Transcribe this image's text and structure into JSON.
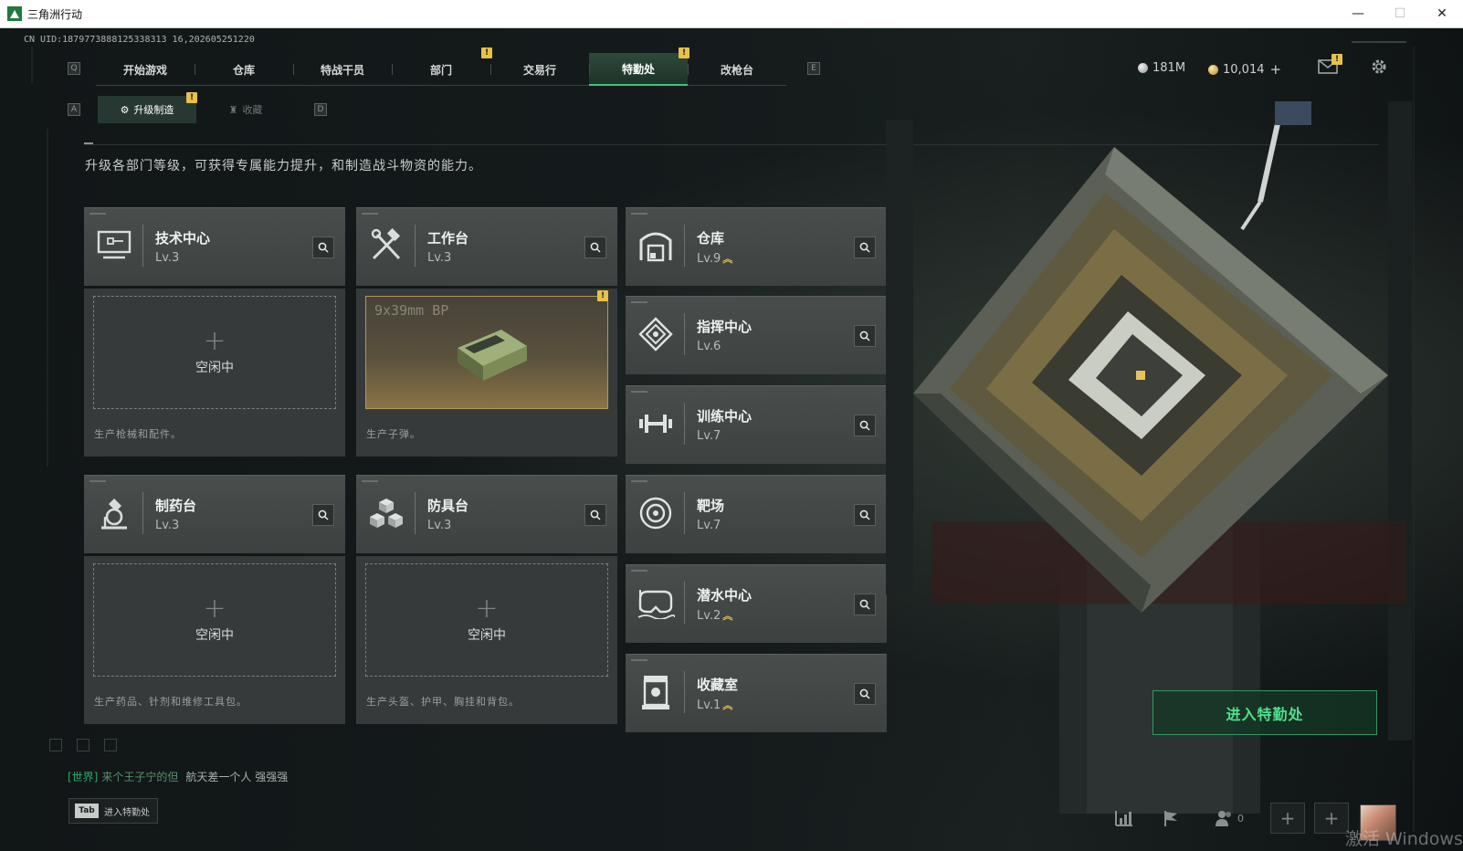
{
  "window": {
    "title": "三角洲行动",
    "minimize": "—",
    "maximize": "☐",
    "close": "✕"
  },
  "uid": "CN UID:1879773888125338313 16,202605251220",
  "nav": {
    "left_key": "Q",
    "right_key": "E",
    "tabs": [
      {
        "label": "开始游戏"
      },
      {
        "label": "仓库"
      },
      {
        "label": "特战干员"
      },
      {
        "label": "部门"
      },
      {
        "label": "交易行"
      },
      {
        "label": "特勤处"
      },
      {
        "label": "改枪台"
      }
    ],
    "active_tab": "特勤处",
    "badge": "!"
  },
  "currency": {
    "silver": "181M",
    "gold": "10,014",
    "gold_add": "+"
  },
  "subtabs": {
    "left_key": "A",
    "right_key": "D",
    "items": [
      {
        "label": "升级制造"
      },
      {
        "label": "收藏"
      }
    ]
  },
  "description": "升级各部门等级，可获得专属能力提升，和制造战斗物资的能力。",
  "cards": {
    "tech": {
      "name": "技术中心",
      "level": "Lv.3",
      "slot_idle": "空闲中",
      "slot_desc": "生产枪械和配件。",
      "plus": "+"
    },
    "workbench": {
      "name": "工作台",
      "level": "Lv.3",
      "slot_item": "9x39mm BP",
      "slot_desc": "生产子弹。"
    },
    "pharmacy": {
      "name": "制药台",
      "level": "Lv.3",
      "slot_idle": "空闲中",
      "slot_desc": "生产药品、针剂和维修工具包。",
      "plus": "+"
    },
    "armor": {
      "name": "防具台",
      "level": "Lv.3",
      "slot_idle": "空闲中",
      "slot_desc": "生产头盔、护甲、胸挂和背包。",
      "plus": "+"
    },
    "warehouse": {
      "name": "仓库",
      "level": "Lv.9"
    },
    "command": {
      "name": "指挥中心",
      "level": "Lv.6"
    },
    "training": {
      "name": "训练中心",
      "level": "Lv.7"
    },
    "range": {
      "name": "靶场",
      "level": "Lv.7"
    },
    "diving": {
      "name": "潜水中心",
      "level": "Lv.2"
    },
    "collection": {
      "name": "收藏室",
      "level": "Lv.1"
    }
  },
  "upgrade_arrow": "︽",
  "enter_button": "进入特勤处",
  "chat": {
    "channel": "[世界]",
    "user": "来个王子宁的但",
    "message": "航天差一个人  强强强"
  },
  "tab_hint": {
    "key": "Tab",
    "label": "进入特勤处"
  },
  "friends_count": "0",
  "watermark": "激活 Windows",
  "colors": {
    "accent_green": "#3fc47a",
    "badge_yellow": "#e8c14a",
    "upgrade_gold": "#e7b94a"
  }
}
